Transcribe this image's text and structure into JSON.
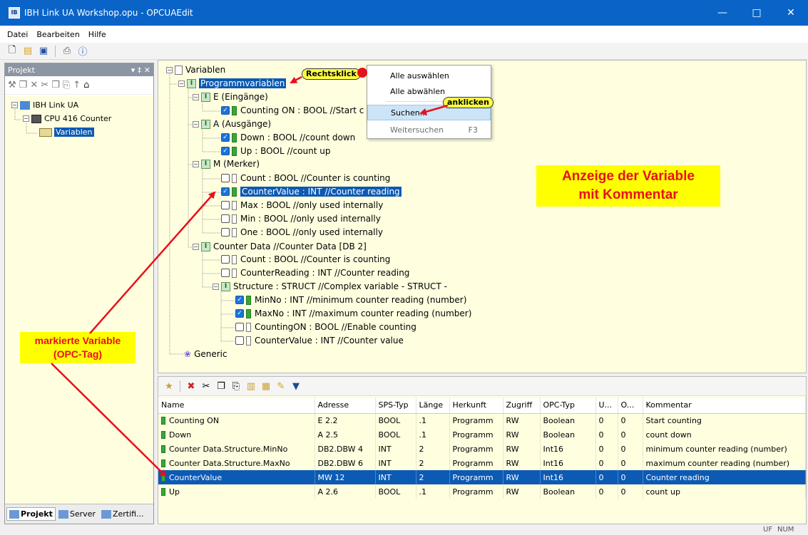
{
  "window": {
    "title": "IBH Link UA Workshop.opu - OPCUAEdit",
    "app_icon": "ibh-app-icon",
    "controls": [
      "minimize",
      "maximize",
      "close"
    ]
  },
  "menubar": [
    "Datei",
    "Bearbeiten",
    "Hilfe"
  ],
  "toolbar": [
    "new-file-icon",
    "open-folder-icon",
    "save-icon",
    "print-icon",
    "help-icon"
  ],
  "project_panel": {
    "title": "Projekt",
    "pin_symbols": "▾ ‡ ✕",
    "tree": [
      {
        "label": "IBH Link UA",
        "level": 0
      },
      {
        "label": "CPU 416 Counter",
        "level": 1
      },
      {
        "label": "Variablen",
        "level": 2,
        "selected": true
      }
    ],
    "tabs": [
      "Projekt",
      "Server",
      "Zertifi..."
    ]
  },
  "variable_tree": [
    {
      "label": "Variablen",
      "level": 0,
      "icon": "document",
      "expander": "-"
    },
    {
      "label": "Programmvariablen",
      "level": 1,
      "icon": "folder",
      "expander": "-",
      "selected": true
    },
    {
      "label": "E (Eingänge)",
      "level": 2,
      "icon": "folder",
      "expander": "-"
    },
    {
      "label": "Counting ON : BOOL  //Start c",
      "level": 3,
      "checked": true
    },
    {
      "label": "A (Ausgänge)",
      "level": 2,
      "icon": "folder",
      "expander": "-"
    },
    {
      "label": "Down : BOOL   //count down",
      "level": 3,
      "checked": true
    },
    {
      "label": "Up : BOOL   //count up",
      "level": 3,
      "checked": true
    },
    {
      "label": "M (Merker)",
      "level": 2,
      "icon": "folder",
      "expander": "-"
    },
    {
      "label": "Count : BOOL   //Counter is counting",
      "level": 3,
      "checked": false
    },
    {
      "label": "CounterValue : INT   //Counter reading",
      "level": 3,
      "checked": true,
      "selected": true
    },
    {
      "label": "Max : BOOL   //only used internally",
      "level": 3,
      "checked": false
    },
    {
      "label": "Min : BOOL   //only used internally",
      "level": 3,
      "checked": false
    },
    {
      "label": "One : BOOL   //only used internally",
      "level": 3,
      "checked": false
    },
    {
      "label": "Counter Data   //Counter Data   [DB 2]",
      "level": 2,
      "icon": "folder",
      "expander": "-"
    },
    {
      "label": "Count : BOOL   //Counter is counting",
      "level": 3,
      "checked": false
    },
    {
      "label": "CounterReading : INT   //Counter reading",
      "level": 3,
      "checked": false
    },
    {
      "label": "Structure : STRUCT   //Complex variable - STRUCT -",
      "level": 3,
      "icon": "folder",
      "expander": "-"
    },
    {
      "label": "MinNo : INT   //minimum counter reading (number)",
      "level": 4,
      "checked": true
    },
    {
      "label": "MaxNo : INT   //maximum counter reading (number)",
      "level": 4,
      "checked": true
    },
    {
      "label": "CountingON : BOOL   //Enable counting",
      "level": 4,
      "checked": false
    },
    {
      "label": "CounterValue : INT   //Counter value",
      "level": 4,
      "checked": false
    },
    {
      "label": "Generic",
      "level": 1,
      "icon": "generic"
    }
  ],
  "context_menu": [
    {
      "label": "Alle auswählen"
    },
    {
      "label": "Alle abwählen"
    },
    {
      "label": "Suchen...",
      "highlighted": true
    },
    {
      "label": "Weitersuchen",
      "shortcut": "F3",
      "disabled": true
    }
  ],
  "annotations": {
    "rechtsklick": "Rechtsklick",
    "anklicken": "anklicken",
    "anzeige_line1": "Anzeige der Variable",
    "anzeige_line2": "mit Kommentar",
    "markierte_line1": "markierte Variable",
    "markierte_line2": "(OPC-Tag)"
  },
  "table_toolbar": [
    "new-tag-icon",
    "delete-icon",
    "cut-icon",
    "copy-icon",
    "paste-icon",
    "import-icon",
    "export-icon",
    "edit-pencil-icon",
    "filter-icon"
  ],
  "table": {
    "columns": [
      "Name",
      "Adresse",
      "SPS-Typ",
      "Länge",
      "Herkunft",
      "Zugriff",
      "OPC-Typ",
      "U...",
      "O...",
      "Kommentar"
    ],
    "rows": [
      [
        "Counting ON",
        "E 2.2",
        "BOOL",
        ".1",
        "Programm",
        "RW",
        "Boolean",
        "0",
        "0",
        "Start counting"
      ],
      [
        "Down",
        "A 2.5",
        "BOOL",
        ".1",
        "Programm",
        "RW",
        "Boolean",
        "0",
        "0",
        "count down"
      ],
      [
        "Counter Data.Structure.MinNo",
        "DB2.DBW 4",
        "INT",
        "2",
        "Programm",
        "RW",
        "Int16",
        "0",
        "0",
        "minimum counter reading (number)"
      ],
      [
        "Counter Data.Structure.MaxNo",
        "DB2.DBW 6",
        "INT",
        "2",
        "Programm",
        "RW",
        "Int16",
        "0",
        "0",
        "maximum counter reading (number)"
      ],
      [
        "CounterValue",
        "MW 12",
        "INT",
        "2",
        "Programm",
        "RW",
        "Int16",
        "0",
        "0",
        "Counter reading"
      ],
      [
        "Up",
        "A 2.6",
        "BOOL",
        ".1",
        "Programm",
        "RW",
        "Boolean",
        "0",
        "0",
        "count up"
      ]
    ],
    "selected_row": 4
  },
  "statusbar": {
    "uf": "UF",
    "num": "NUM"
  },
  "colors": {
    "titlebar": "#0a64c8",
    "selection": "#0c5ab4",
    "panel_bg": "#ffffe0",
    "arrow": "#e8101a",
    "note_bg": "#ffff00"
  }
}
